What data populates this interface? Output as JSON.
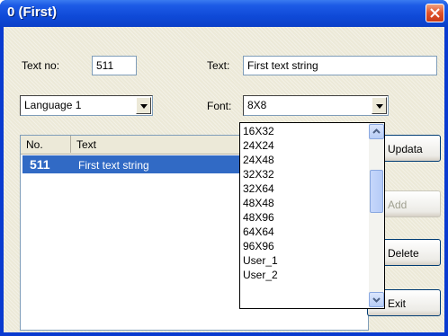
{
  "window": {
    "title": "0 (First)"
  },
  "form": {
    "text_no_label": "Text no:",
    "text_no_value": "511",
    "text_label": "Text:",
    "text_value": "First text string",
    "language_value": "Language 1",
    "font_label": "Font:",
    "font_value": "8X8"
  },
  "list": {
    "columns": [
      "No.",
      "Text"
    ],
    "rows": [
      {
        "no": "511",
        "text": "First text string"
      }
    ]
  },
  "buttons": {
    "update": "Updata",
    "add": "Add",
    "delete": "Delete",
    "exit": "Exit"
  },
  "font_options": [
    "16X32",
    "24X24",
    "24X48",
    "32X32",
    "32X64",
    "48X48",
    "48X96",
    "64X64",
    "96X96",
    "User_1",
    "User_2"
  ],
  "icons": {
    "close": "close-icon",
    "combo_arrow": "chevron-down-icon",
    "scroll_up": "scroll-up-icon",
    "scroll_down": "scroll-down-icon"
  },
  "colors": {
    "titlebar": "#0f4ad8",
    "selection": "#316ac5",
    "close_button": "#e0522a"
  }
}
